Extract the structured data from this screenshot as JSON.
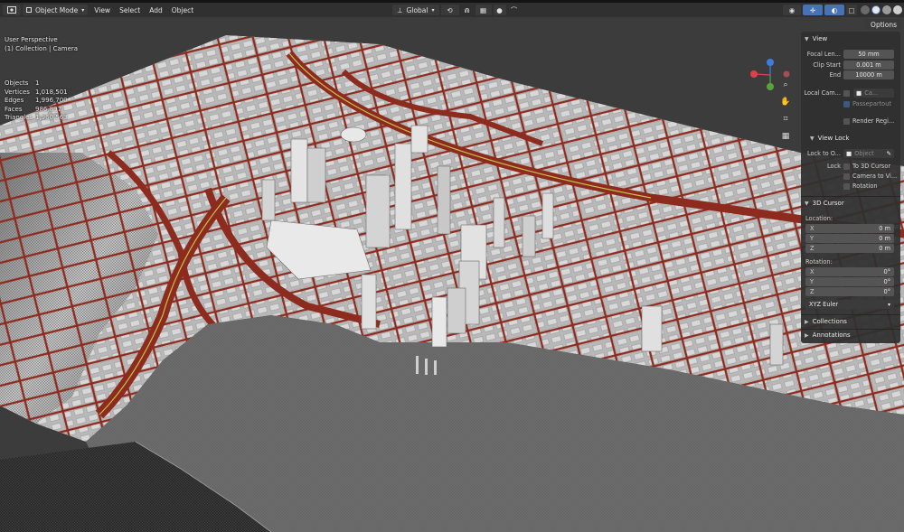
{
  "header": {
    "mode": "Object Mode",
    "menus": [
      "View",
      "Select",
      "Add",
      "Object"
    ],
    "transform_orientation": "Global",
    "options_label": "Options"
  },
  "overlay": {
    "view_name": "User Perspective",
    "collection": "(1) Collection | Camera",
    "stats": [
      {
        "k": "Objects",
        "v": "1"
      },
      {
        "k": "Vertices",
        "v": "1,018,501"
      },
      {
        "k": "Edges",
        "v": "1,996,700"
      },
      {
        "k": "Faces",
        "v": "986,897"
      },
      {
        "k": "Triangles",
        "v": "1,960,563"
      }
    ]
  },
  "npanel": {
    "view": {
      "title": "View",
      "focal_length_label": "Focal Len...",
      "focal_length": "50 mm",
      "clip_start_label": "Clip Start",
      "clip_start": "0.001 m",
      "end_label": "End",
      "end": "10000 m",
      "local_camera_label": "Local Cam...",
      "local_camera_value": "Ca...",
      "passepartout": "Passepartout",
      "render_region": "Render Regi..."
    },
    "view_lock": {
      "title": "View Lock",
      "lock_to_label": "Lock to O...",
      "lock_to_placeholder": "Object",
      "lock_label": "Lock",
      "to_3d_cursor": "To 3D Cursor",
      "camera_to_view": "Camera to Vi...",
      "rotation": "Rotation"
    },
    "cursor": {
      "title": "3D Cursor",
      "location_label": "Location:",
      "location": [
        {
          "axis": "X",
          "value": "0 m"
        },
        {
          "axis": "Y",
          "value": "0 m"
        },
        {
          "axis": "Z",
          "value": "0 m"
        }
      ],
      "rotation_label": "Rotation:",
      "rotation": [
        {
          "axis": "X",
          "value": "0°"
        },
        {
          "axis": "Y",
          "value": "0°"
        },
        {
          "axis": "Z",
          "value": "0°"
        }
      ],
      "rotation_mode": "XYZ Euler"
    },
    "collections_title": "Collections",
    "annotations_title": "Annotations"
  },
  "colors": {
    "accent": "#4772b3",
    "road": "#8c2b1e",
    "water": "#6c6c6c",
    "gizmo_x": "#e0404e",
    "gizmo_y": "#58a33a",
    "gizmo_z": "#3c7ee0"
  }
}
